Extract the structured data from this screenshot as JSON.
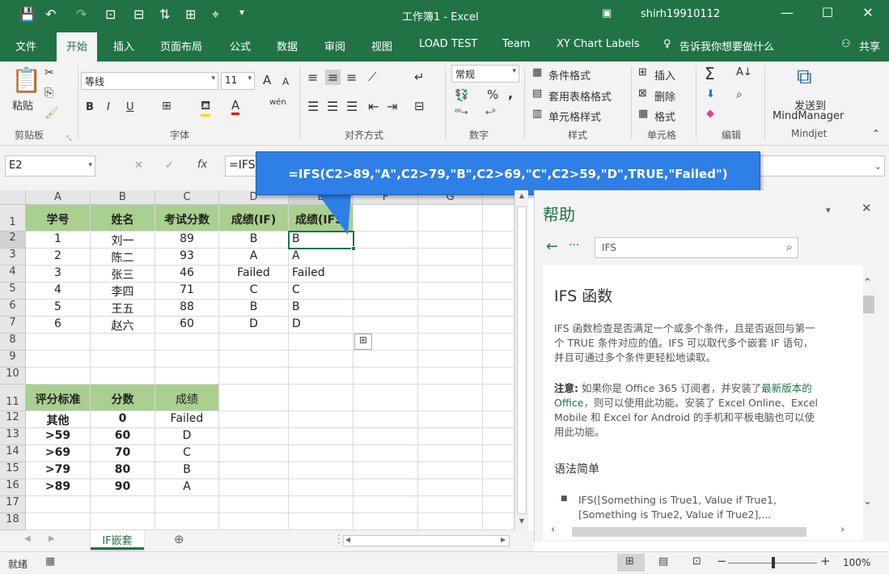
{
  "titlebar": {
    "doc_title": "工作簿1 - Excel",
    "user": "shirh19910112",
    "qat": {
      "save": "💾",
      "undo": "↶",
      "redo": "↷",
      "touch": "⊡"
    },
    "controls": {
      "ribbon_opts": "▣",
      "minimize": "—",
      "maximize": "☐",
      "close": "✕"
    }
  },
  "tabs": [
    "文件",
    "开始",
    "插入",
    "页面布局",
    "公式",
    "数据",
    "审阅",
    "视图",
    "LOAD TEST",
    "Team",
    "XY Chart Labels"
  ],
  "tellme": "告诉我你想要做什么",
  "share": "共享",
  "ribbon": {
    "clipboard": {
      "paste": "粘贴",
      "label": "剪贴板"
    },
    "font": {
      "name": "等线",
      "size": "11",
      "bold": "B",
      "italic": "I",
      "underline": "U",
      "wen": "wén",
      "label": "字体",
      "grow": "A",
      "shrink": "A"
    },
    "align": {
      "label": "对齐方式"
    },
    "number": {
      "format": "常规",
      "percent": "%",
      "comma": ",",
      "label": "数字"
    },
    "styles": {
      "cond": "条件格式",
      "table": "套用表格格式",
      "cell": "单元格样式",
      "label": "样式"
    },
    "cells": {
      "insert": "插入",
      "delete": "删除",
      "format": "格式",
      "label": "单元格"
    },
    "edit": {
      "label": "编辑",
      "sum": "Σ"
    },
    "mind": {
      "send": "发送到",
      "app": "MindManager",
      "label": "Mindjet"
    }
  },
  "formula": {
    "namebox": "E2",
    "fx": "fx",
    "text": "=IFS"
  },
  "callout": "=IFS(C2>89,\"A\",C2>79,\"B\",C2>69,\"C\",C2>59,\"D\",TRUE,\"Failed\")",
  "columns": [
    "A",
    "B",
    "C",
    "D",
    "E",
    "F",
    "G"
  ],
  "rows": [
    "1",
    "2",
    "3",
    "4",
    "5",
    "6",
    "7",
    "8",
    "9",
    "10",
    "11",
    "12",
    "13",
    "14",
    "15",
    "16",
    "17",
    "18"
  ],
  "header_row": [
    "学号",
    "姓名",
    "考试分数",
    "成绩(IF)",
    "成绩(IFS)"
  ],
  "data_rows": [
    [
      "1",
      "刘一",
      "89",
      "B",
      "B"
    ],
    [
      "2",
      "陈二",
      "93",
      "A",
      "A"
    ],
    [
      "3",
      "张三",
      "46",
      "Failed",
      "Failed"
    ],
    [
      "4",
      "李四",
      "71",
      "C",
      "C"
    ],
    [
      "5",
      "王五",
      "88",
      "B",
      "B"
    ],
    [
      "6",
      "赵六",
      "60",
      "D",
      "D"
    ]
  ],
  "criteria_header": [
    "评分标准",
    "分数",
    "成绩"
  ],
  "criteria_rows": [
    [
      "其他",
      "0",
      "Failed"
    ],
    [
      ">59",
      "60",
      "D"
    ],
    [
      ">69",
      "70",
      "C"
    ],
    [
      ">79",
      "80",
      "B"
    ],
    [
      ">89",
      "90",
      "A"
    ]
  ],
  "sheet_tab": "IF嵌套",
  "help": {
    "title": "帮助",
    "search": "IFS",
    "heading": "IFS 函数",
    "p1": "IFS 函数检查是否满足一个或多个条件，且是否返回与第一个 TRUE 条件对应的值。IFS 可以取代多个嵌套 IF 语句，并且可通过多个条件更轻松地读取。",
    "note_label": "注意:",
    "note_a": " 如果你是 Office 365 订阅者，并安装了",
    "note_link": "最新版本的 Office",
    "note_b": "，则可以使用此功能。安装了 Excel Online、Excel Mobile 和 Excel for Android 的手机和平板电脑也可以使用此功能。",
    "syntax": "语法简单",
    "bullet": "IFS([Something is True1, Value if True1, [Something is True2, Value if True2],..."
  },
  "status": {
    "ready": "就绪",
    "zoom": "100%"
  },
  "colors": {
    "brand": "#217346",
    "accent": "#2e7fe6",
    "green_fill": "#a9d08e"
  }
}
